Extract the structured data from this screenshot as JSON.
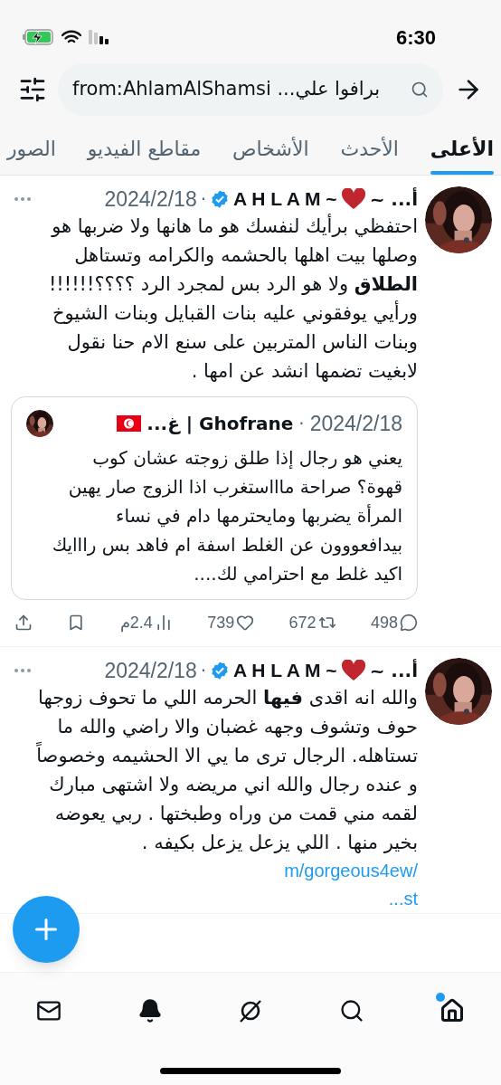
{
  "status_bar": {
    "time": "6:30"
  },
  "search": {
    "value": "برافوا علي... from:AhlamAlShamsi"
  },
  "tabs": [
    {
      "label": "الأعلى",
      "selected": true
    },
    {
      "label": "الأحدث",
      "selected": false
    },
    {
      "label": "الأشخاص",
      "selected": false
    },
    {
      "label": "مقاطع الفيديو",
      "selected": false
    },
    {
      "label": "الصور",
      "selected": false
    }
  ],
  "tweets": [
    {
      "name_start": "أ... ~",
      "name_end": "~ A H L A M",
      "verified": true,
      "separator": "·",
      "date": "2024/2/18",
      "text": "احتفظي برأيك لنفسك هو ما هانها ولا ضربها هو وصلها بيت اهلها بالحشمه والكرامه وتستاهل **الطلاق** ولا هو الرد بس لمجرد الرد ؟؟؟؟!!!!!! ورأيي يوفقوني عليه بنات القبايل وبنات الشيوخ وبنات الناس المتربين على سنع الام حنا نقول لابغيت تضمها انشد عن امها .",
      "quote": {
        "name": "Ghofrane | غ...",
        "separator": "·",
        "date": "2024/2/18",
        "text": "يعني هو رجال إذا طلق زوجته عشان كوب قهوة؟ صراحة ماااستغرب اذا الزوج صار يهين المرأة يضربها ومايحترمها دام في نساء بيدافعووون عن الغلط اسفة ام فاهد بس رااايك اكيد غلط مع احترامي لك...."
      },
      "stats": {
        "replies": "498",
        "retweets": "672",
        "likes": "739",
        "views": "2.4م"
      }
    },
    {
      "name_start": "أ... ~",
      "name_end": "~ A H L A M",
      "verified": true,
      "separator": "·",
      "date": "2024/2/18",
      "text": "والله انه اقدى **فيها**  الحرمه اللي ما تحوف زوجها حوف وتشوف وجهه غضبان والا راضي والله ما تستاهله.  الرجال ترى ما يي الا الحشيمه وخصوصاً و عنده رجال والله اني مريضه ولا اشتهى مبارك لقمه مني قمت من وراه وطبختها . ربي يعوضه بخير منها . اللي يزعل يزعل بكيفه .",
      "links": [
        "m/gorgeous4ew/",
        "...st"
      ]
    }
  ],
  "nav": [
    {
      "kind": "home",
      "selected": true,
      "badge": true
    },
    {
      "kind": "search",
      "selected": false,
      "badge": false
    },
    {
      "kind": "grok",
      "selected": false,
      "badge": false
    },
    {
      "kind": "bell",
      "selected": false,
      "badge": false
    },
    {
      "kind": "mail",
      "selected": false,
      "badge": false
    }
  ]
}
